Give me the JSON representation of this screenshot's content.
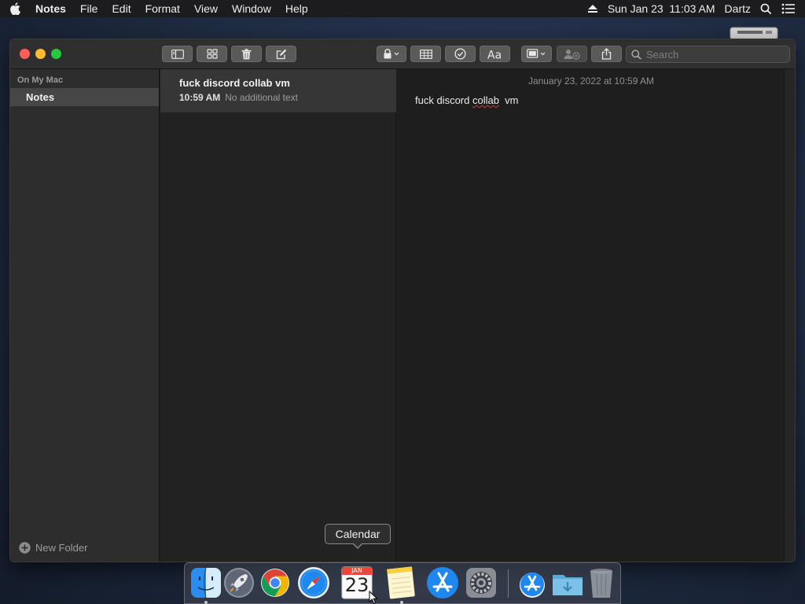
{
  "menubar": {
    "app_name": "Notes",
    "items": [
      "File",
      "Edit",
      "Format",
      "View",
      "Window",
      "Help"
    ],
    "clock": "Sun Jan 23  11:03 AM",
    "user": "Dartz"
  },
  "window": {
    "toolbar": {
      "search_placeholder": "Search"
    },
    "sidebar": {
      "section_title": "On My Mac",
      "folders": [
        {
          "label": "Notes",
          "selected": true
        }
      ],
      "new_folder_label": "New Folder"
    },
    "note_list": {
      "notes": [
        {
          "title": "fuck discord collab vm",
          "time": "10:59 AM",
          "preview": "No additional text",
          "selected": true
        }
      ]
    },
    "editor": {
      "date": "January 23, 2022 at 10:59 AM",
      "body_before": "fuck discord ",
      "body_misspelled": "collab",
      "body_after": "  vm"
    }
  },
  "dock": {
    "tooltip": "Calendar",
    "calendar_month": "JAN",
    "calendar_day": "23",
    "apps": [
      "Finder",
      "Launchpad",
      "Google Chrome",
      "Safari",
      "Calendar",
      "Notes",
      "App Store",
      "System Preferences",
      "App Store",
      "Downloads",
      "Trash"
    ]
  },
  "colors": {
    "close": "#ff5f57",
    "minimize": "#febc2e",
    "zoom": "#28c840",
    "accent_blue": "#1e88f0"
  }
}
